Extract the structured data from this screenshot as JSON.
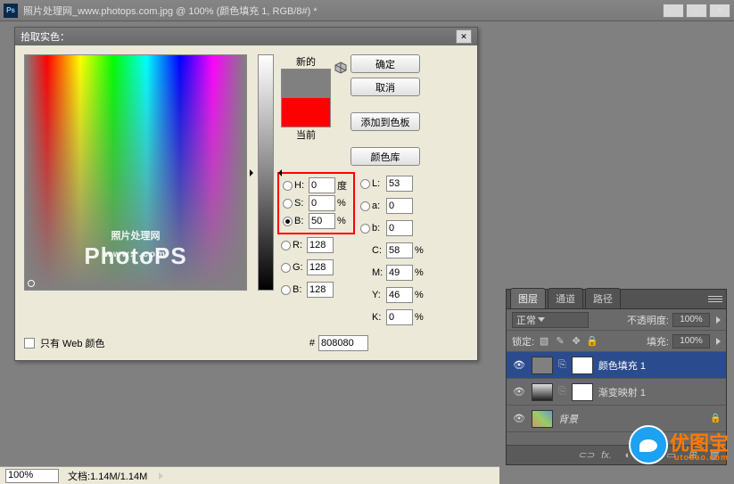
{
  "window": {
    "title": "照片处理网_www.photops.com.jpg @ 100% (颜色填充 1, RGB/8#) *",
    "minimize": "—",
    "maximize": "☐",
    "close": "✕"
  },
  "dialog": {
    "title": "拾取实色：",
    "close": "✕",
    "new_label": "新的",
    "current_label": "当前",
    "ok": "确定",
    "cancel": "取消",
    "add_swatch": "添加到色板",
    "color_lib": "颜色库",
    "only_web": "只有 Web 颜色",
    "hex_prefix": "#",
    "hex": "808080",
    "fields": {
      "H": {
        "label": "H:",
        "value": "0",
        "unit": "度"
      },
      "S": {
        "label": "S:",
        "value": "0",
        "unit": "%"
      },
      "B": {
        "label": "B:",
        "value": "50",
        "unit": "%"
      },
      "R": {
        "label": "R:",
        "value": "128",
        "unit": ""
      },
      "G": {
        "label": "G:",
        "value": "128",
        "unit": ""
      },
      "Bch": {
        "label": "B:",
        "value": "128",
        "unit": ""
      },
      "L": {
        "label": "L:",
        "value": "53",
        "unit": ""
      },
      "a": {
        "label": "a:",
        "value": "0",
        "unit": ""
      },
      "b": {
        "label": "b:",
        "value": "0",
        "unit": ""
      },
      "C": {
        "label": "C:",
        "value": "58",
        "unit": "%"
      },
      "M": {
        "label": "M:",
        "value": "49",
        "unit": "%"
      },
      "Y": {
        "label": "Y:",
        "value": "46",
        "unit": "%"
      },
      "K": {
        "label": "K:",
        "value": "0",
        "unit": "%"
      }
    },
    "watermark": {
      "line1": "照片处理网",
      "line2": "PhotoPS",
      "line3": "www.                    .com"
    }
  },
  "panel": {
    "tabs": {
      "layers": "图层",
      "channels": "通道",
      "paths": "路径"
    },
    "blend_mode": "正常",
    "opacity_label": "不透明度:",
    "opacity": "100%",
    "lock_label": "锁定:",
    "fill_label": "填充:",
    "fill": "100%",
    "layers": [
      {
        "name": "颜色填充 1"
      },
      {
        "name": "渐变映射 1"
      },
      {
        "name": "背景"
      }
    ],
    "footer_icons": {
      "link": "⊂⊃",
      "fx": "fx.",
      "mask": "◐",
      "adjust": "◑",
      "folder": "▭",
      "new": "⊞",
      "trash": "🗑"
    }
  },
  "status": {
    "zoom": "100%",
    "doc_label": "文档:",
    "doc": "1.14M/1.14M"
  },
  "utobao": {
    "text": "优图宝",
    "url": "utobao.com"
  }
}
